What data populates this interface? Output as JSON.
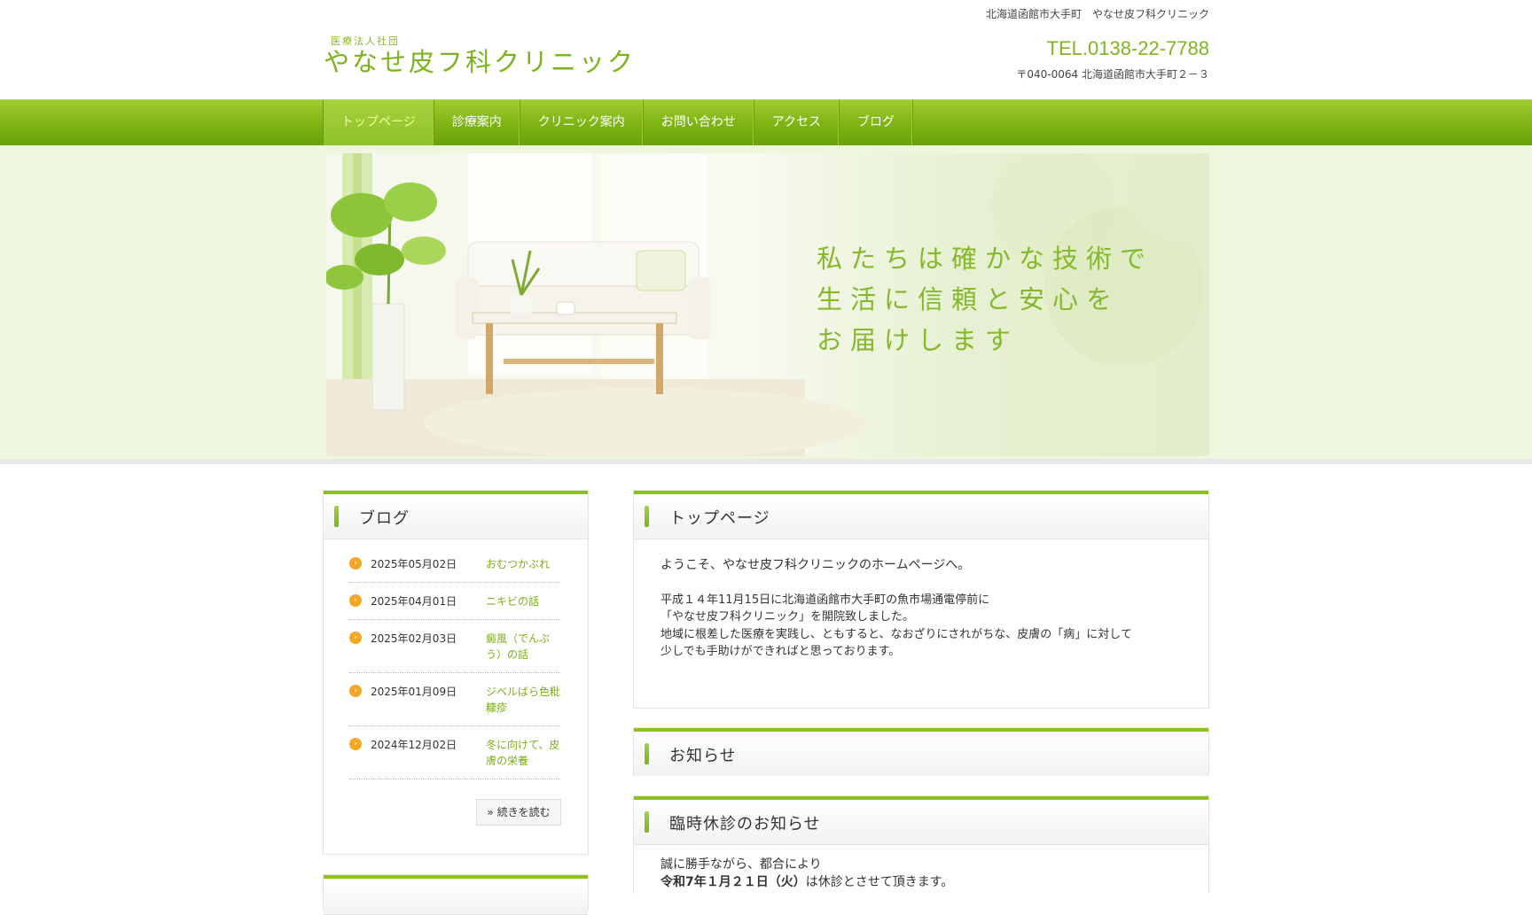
{
  "header": {
    "top_address": "北海道函館市大手町　やなせ皮フ科クリニック",
    "logo_small": "医療法人社団",
    "logo_main": "やなせ皮フ科クリニック",
    "tel": "TEL.0138-22-7788",
    "postal": "〒040-0064 北海道函館市大手町２－３"
  },
  "nav": {
    "items": [
      {
        "label": "トップページ"
      },
      {
        "label": "診療案内"
      },
      {
        "label": "クリニック案内"
      },
      {
        "label": "お問い合わせ"
      },
      {
        "label": "アクセス"
      },
      {
        "label": "ブログ"
      }
    ],
    "active_index": 0
  },
  "hero": {
    "line1": "私たちは確かな技術で",
    "line2": "生活に信頼と安心を",
    "line3": "お届けします"
  },
  "sidebar": {
    "blog_title": "ブログ",
    "posts": [
      {
        "date": "2025年05月02日",
        "title": "おむつかぶれ"
      },
      {
        "date": "2025年04月01日",
        "title": "ニキビの話"
      },
      {
        "date": "2025年02月03日",
        "title": "癜風（でんぷう）の話"
      },
      {
        "date": "2025年01月09日",
        "title": "ジベルばら色粃糠疹"
      },
      {
        "date": "2024年12月02日",
        "title": "冬に向けて、皮膚の栄養"
      }
    ],
    "more_label": "» 続きを読む"
  },
  "main": {
    "top_title": "トップページ",
    "welcome": "ようこそ、やなせ皮フ科クリニックのホームページへ。",
    "para1": "平成１４年11月15日に北海道函館市大手町の魚市場通電停前に",
    "para2": "「やなせ皮フ科クリニック」を開院致しました。",
    "para3": "地域に根差した医療を実践し、ともすると、なおざりにされがちな、皮膚の「病」に対して",
    "para4": "少しでも手助けができればと思っております。",
    "news_title": "お知らせ",
    "closure_title": "臨時休診のお知らせ",
    "closure_line1": "誠に勝手ながら、都合により",
    "closure_bold": "令和7年１月２１日（火）",
    "closure_rest": "は休診とさせて頂きます。"
  },
  "colors": {
    "brand_green": "#7cb21d",
    "nav_green": "#7db313",
    "bullet_orange": "#f5a623"
  }
}
